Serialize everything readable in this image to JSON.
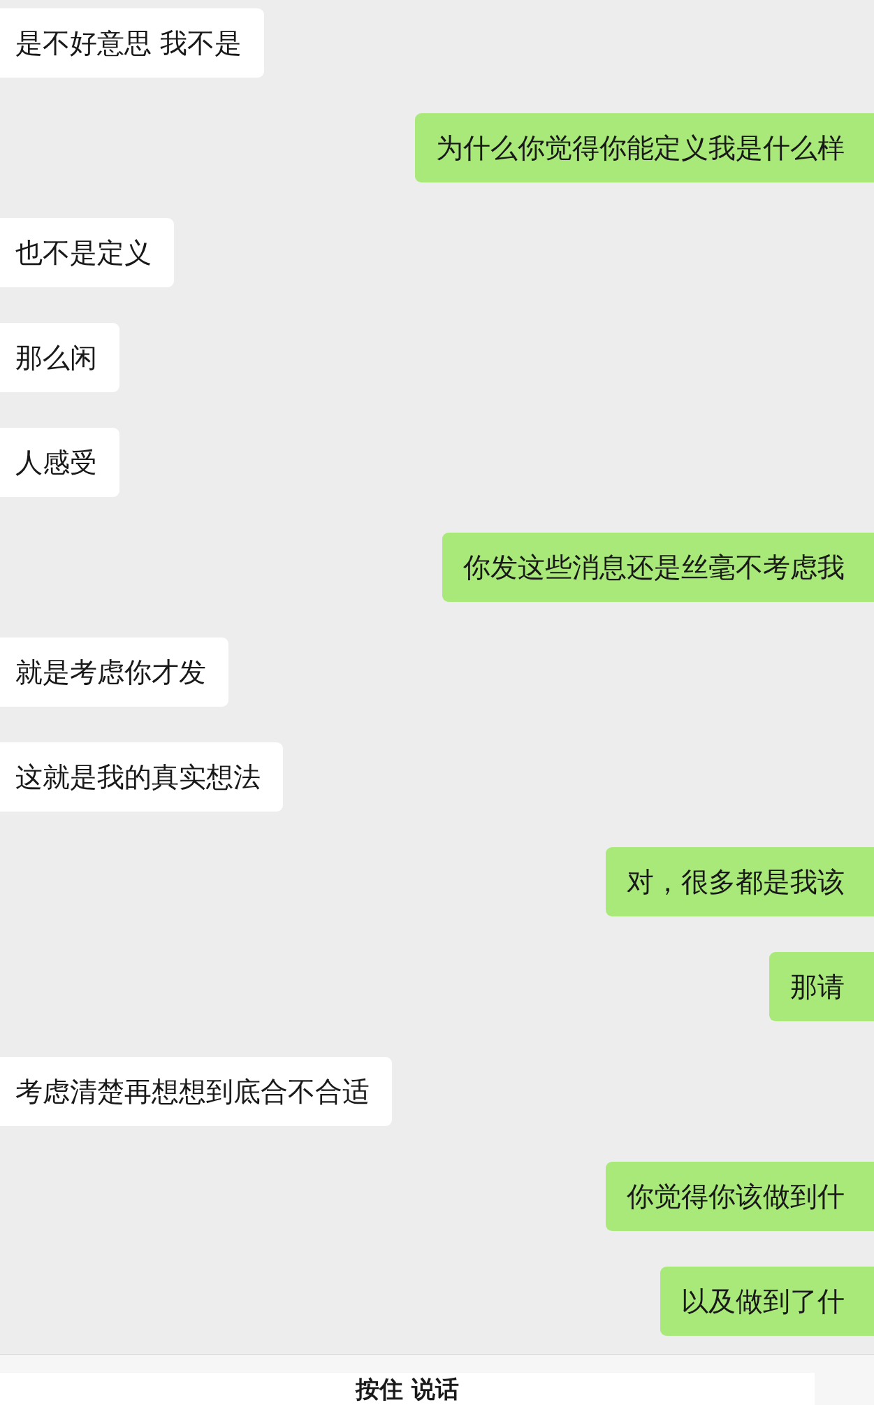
{
  "messages": [
    {
      "kind": "received",
      "text": "是不好意思 我不是"
    },
    {
      "kind": "sent",
      "text": "为什么你觉得你能定义我是什么样"
    },
    {
      "kind": "received",
      "text": "也不是定义"
    },
    {
      "kind": "received",
      "text": "那么闲"
    },
    {
      "kind": "received",
      "text": "人感受"
    },
    {
      "kind": "sent",
      "text": "你发这些消息还是丝毫不考虑我"
    },
    {
      "kind": "received",
      "text": "就是考虑你才发"
    },
    {
      "kind": "received",
      "text": "这就是我的真实想法"
    },
    {
      "kind": "sent",
      "text": "对，很多都是我该"
    },
    {
      "kind": "sent",
      "text": "那请"
    },
    {
      "kind": "received",
      "text": "考虑清楚再想想到底合不合适"
    },
    {
      "kind": "sent",
      "text": "你觉得你该做到什"
    },
    {
      "kind": "sent",
      "text": "以及做到了什"
    }
  ],
  "input_bar": {
    "talk_button": "按住 说话"
  }
}
